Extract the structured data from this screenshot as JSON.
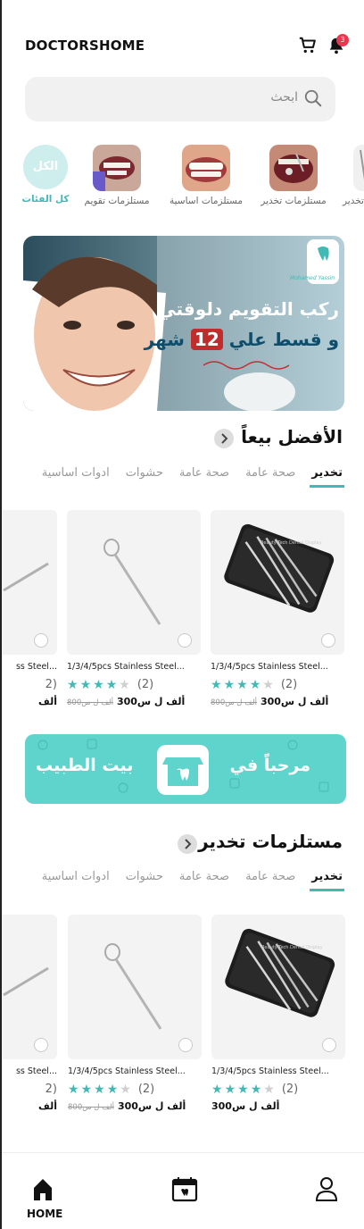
{
  "app": {
    "logo": "DOCTORSHOME"
  },
  "header": {
    "cart_icon": "cart-icon",
    "bell_icon": "bell-icon",
    "notification_count": "3"
  },
  "search": {
    "placeholder": "ابحث"
  },
  "categories": [
    {
      "label": "كل الفئات",
      "circle_text": "الكل"
    },
    {
      "label": "مستلزمات تقويم"
    },
    {
      "label": "مستلزمات اساسية"
    },
    {
      "label": "مستلزمات تخدير"
    },
    {
      "label": "تخدير"
    }
  ],
  "banner": {
    "line1": "ركب التقويم دلوقتي",
    "line2_a": "و قسط علي",
    "line2_num": "12",
    "line2_b": "شهر",
    "brand": "Mohamed Yassin"
  },
  "section1": {
    "title": "الأفضل بيعاً",
    "tabs": [
      "تخدير",
      "صحة عامة",
      "صحة عامة",
      "حشوات",
      "ادوات اساسية"
    ]
  },
  "section2": {
    "title": "مستلزمات تخدير",
    "tabs": [
      "تخدير",
      "صحة عامة",
      "صحة عامة",
      "حشوات",
      "ادوات اساسية"
    ]
  },
  "products_row1": [
    {
      "name": "1/3/4/5pcs Stainless Steel...",
      "rating_count": "(2)",
      "price": "300ألف ل س",
      "old_price": "800ألف ل س",
      "stars": 4
    },
    {
      "name": "1/3/4/5pcs Stainless Steel...",
      "rating_count": "(2)",
      "price": "300ألف ل س",
      "old_price": "800ألف ل س",
      "stars": 4
    },
    {
      "name": "ss Steel...",
      "rating_count": "2)",
      "price": "ألف",
      "old_price": "",
      "stars": 0
    }
  ],
  "products_row2": [
    {
      "name": "1/3/4/5pcs Stainless Steel...",
      "rating_count": "(2)",
      "price": "300ألف ل س",
      "old_price": "",
      "stars": 4
    },
    {
      "name": "1/3/4/5pcs Stainless Steel...",
      "rating_count": "(2)",
      "price": "300ألف ل س",
      "old_price": "800ألف ل س",
      "stars": 4
    },
    {
      "name": "ss Steel...",
      "rating_count": "2)",
      "price": "ألف",
      "old_price": "",
      "stars": 0
    }
  ],
  "product_box_text": "Beauty Tech Dental Display",
  "welcome": {
    "left_text": "بيت الطبيب",
    "right_text": "مرحباً في"
  },
  "bottom_nav": {
    "home_label": "HOME"
  },
  "colors": {
    "accent": "#41b9b5",
    "welcome_bg": "#5fd4cd",
    "badge": "#e8374f"
  }
}
